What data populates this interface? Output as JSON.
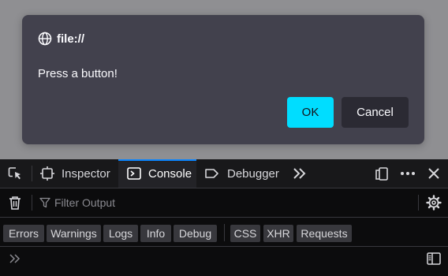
{
  "dialog": {
    "origin": "file://",
    "message": "Press a button!",
    "ok_label": "OK",
    "cancel_label": "Cancel",
    "ok_color": "#00ddff",
    "background": "#42414d"
  },
  "devtools": {
    "tabs": [
      {
        "label": "Inspector",
        "icon": "inspector-icon"
      },
      {
        "label": "Console",
        "icon": "console-icon",
        "selected": true
      },
      {
        "label": "Debugger",
        "icon": "debugger-icon"
      }
    ],
    "accent": "#0a84ff",
    "filter": {
      "placeholder": "Filter Output"
    },
    "filters": [
      "Errors",
      "Warnings",
      "Logs",
      "Info",
      "Debug",
      "CSS",
      "XHR",
      "Requests"
    ]
  }
}
